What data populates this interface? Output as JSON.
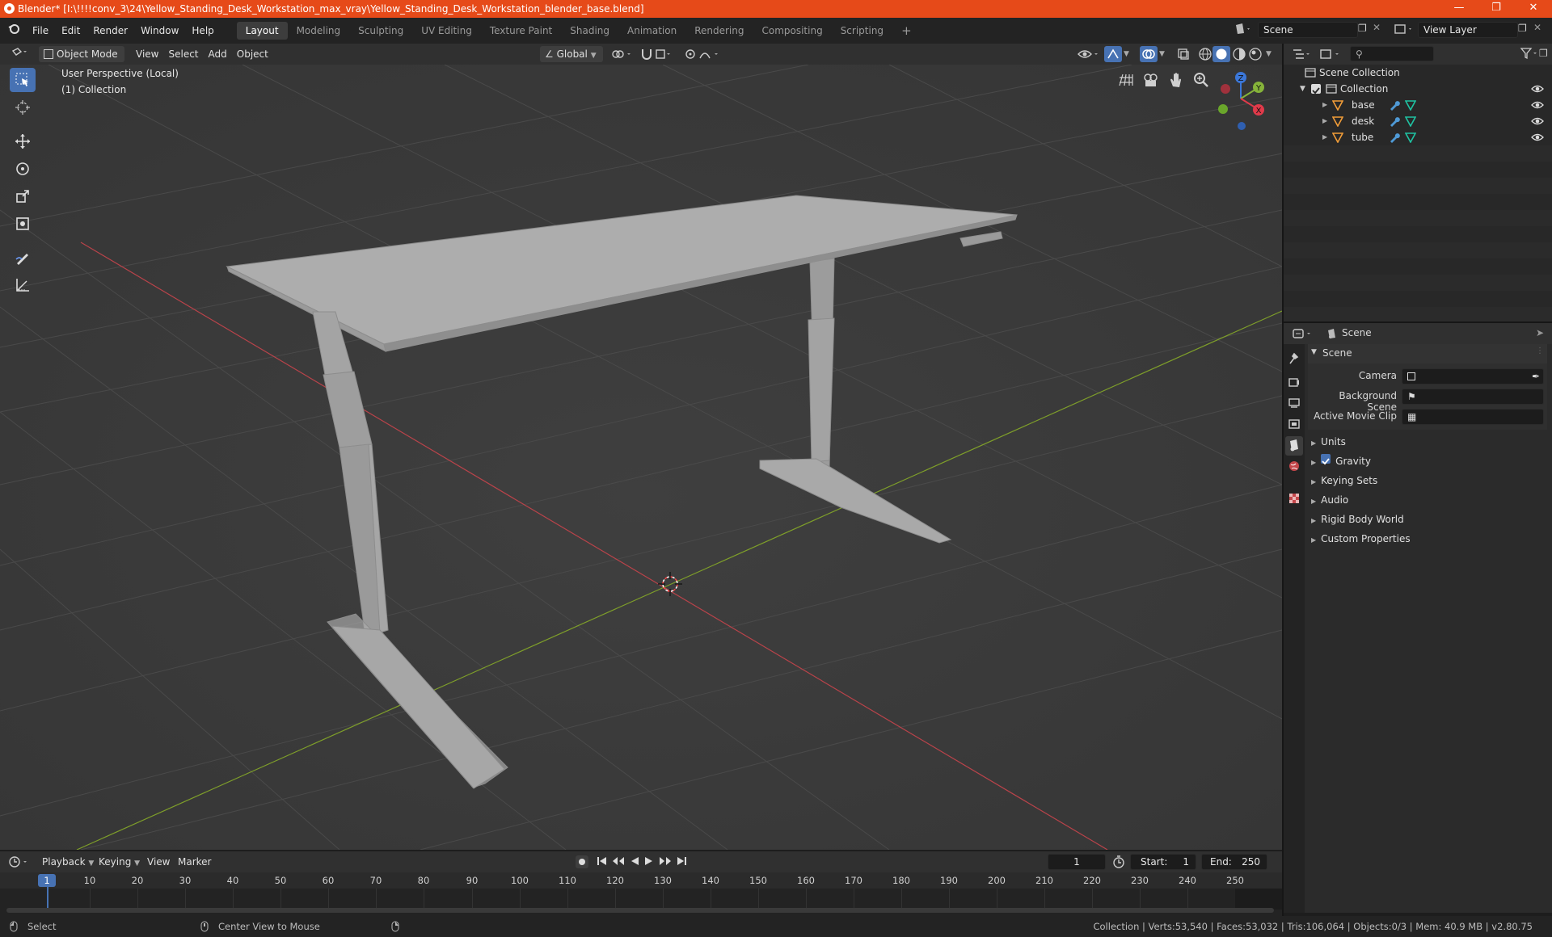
{
  "window": {
    "title": "Blender* [I:\\!!!!conv_3\\24\\Yellow_Standing_Desk_Workstation_max_vray\\Yellow_Standing_Desk_Workstation_blender_base.blend]",
    "accent": "#e64a19"
  },
  "menu": {
    "items": [
      "File",
      "Edit",
      "Render",
      "Window",
      "Help"
    ]
  },
  "workspaces": {
    "tabs": [
      "Layout",
      "Modeling",
      "Sculpting",
      "UV Editing",
      "Texture Paint",
      "Shading",
      "Animation",
      "Rendering",
      "Compositing",
      "Scripting"
    ],
    "active": "Layout"
  },
  "scene_selector": {
    "value": "Scene"
  },
  "view_layer_selector": {
    "value": "View Layer"
  },
  "viewport_header": {
    "mode": "Object Mode",
    "menus": [
      "View",
      "Select",
      "Add",
      "Object"
    ],
    "transform_orientation": "Global"
  },
  "viewport": {
    "perspective": "User Perspective (Local)",
    "collection": "(1) Collection",
    "gizmo_axes": {
      "x": "X",
      "y": "Y",
      "z": "Z"
    }
  },
  "outliner": {
    "root": "Scene Collection",
    "collection": "Collection",
    "objects": [
      "base",
      "desk",
      "tube"
    ]
  },
  "properties": {
    "header": "Scene",
    "panel_title": "Scene",
    "fields": {
      "camera_label": "Camera",
      "background_scene_label": "Background Scene",
      "active_movie_clip_label": "Active Movie Clip"
    },
    "sections": [
      "Units",
      "Gravity",
      "Keying Sets",
      "Audio",
      "Rigid Body World",
      "Custom Properties"
    ],
    "gravity_enabled": true
  },
  "timeline": {
    "menus": [
      "Playback",
      "Keying",
      "View",
      "Marker"
    ],
    "current_frame": "1",
    "start_label": "Start:",
    "start": "1",
    "end_label": "End:",
    "end": "250",
    "ruler": [
      "1",
      "10",
      "20",
      "30",
      "40",
      "50",
      "60",
      "70",
      "80",
      "90",
      "100",
      "110",
      "120",
      "130",
      "140",
      "150",
      "160",
      "170",
      "180",
      "190",
      "200",
      "210",
      "220",
      "230",
      "240",
      "250"
    ]
  },
  "statusbar": {
    "left_action": "Select",
    "middle_action": "Center View to Mouse",
    "stats": "Collection | Verts:53,540 | Faces:53,032 | Tris:106,064 | Objects:0/3 | Mem: 40.9 MB | v2.80.75"
  }
}
